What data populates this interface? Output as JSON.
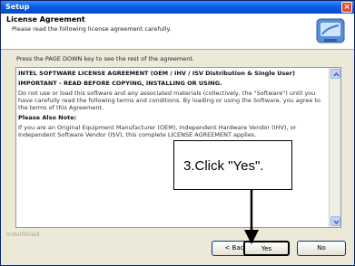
{
  "window": {
    "title": "Setup",
    "close_label": "×"
  },
  "header": {
    "title": "License Agreement",
    "subtitle": "Please read the following license agreement carefully."
  },
  "instruction": "Press the PAGE DOWN key to see the rest of the agreement.",
  "license": {
    "paragraphs": [
      "INTEL SOFTWARE LICENSE AGREEMENT (OEM / IHV / ISV Distribution & Single User)",
      "IMPORTANT - READ BEFORE COPYING, INSTALLING OR USING.",
      "Do not use or load this software and any associated materials (collectively, the \"Software\") until you have carefully read the following terms and conditions. By loading or using the Software, you agree to the terms of this Agreement.",
      "Please Also Note:",
      "If you are an Original Equipment Manufacturer (OEM), Independent Hardware Vendor (IHV), or Independent Software Vendor (ISV), this complete LICENSE AGREEMENT applies."
    ]
  },
  "back_link": "InstallShield",
  "buttons": {
    "back": "< Back",
    "yes": "Yes",
    "no": "No"
  },
  "callout": {
    "text": "3.Click  \"Yes\"."
  },
  "colors": {
    "titlebar": "#0a5de8",
    "dialog_bg": "#ece9d8",
    "callout_border": "#000000"
  }
}
